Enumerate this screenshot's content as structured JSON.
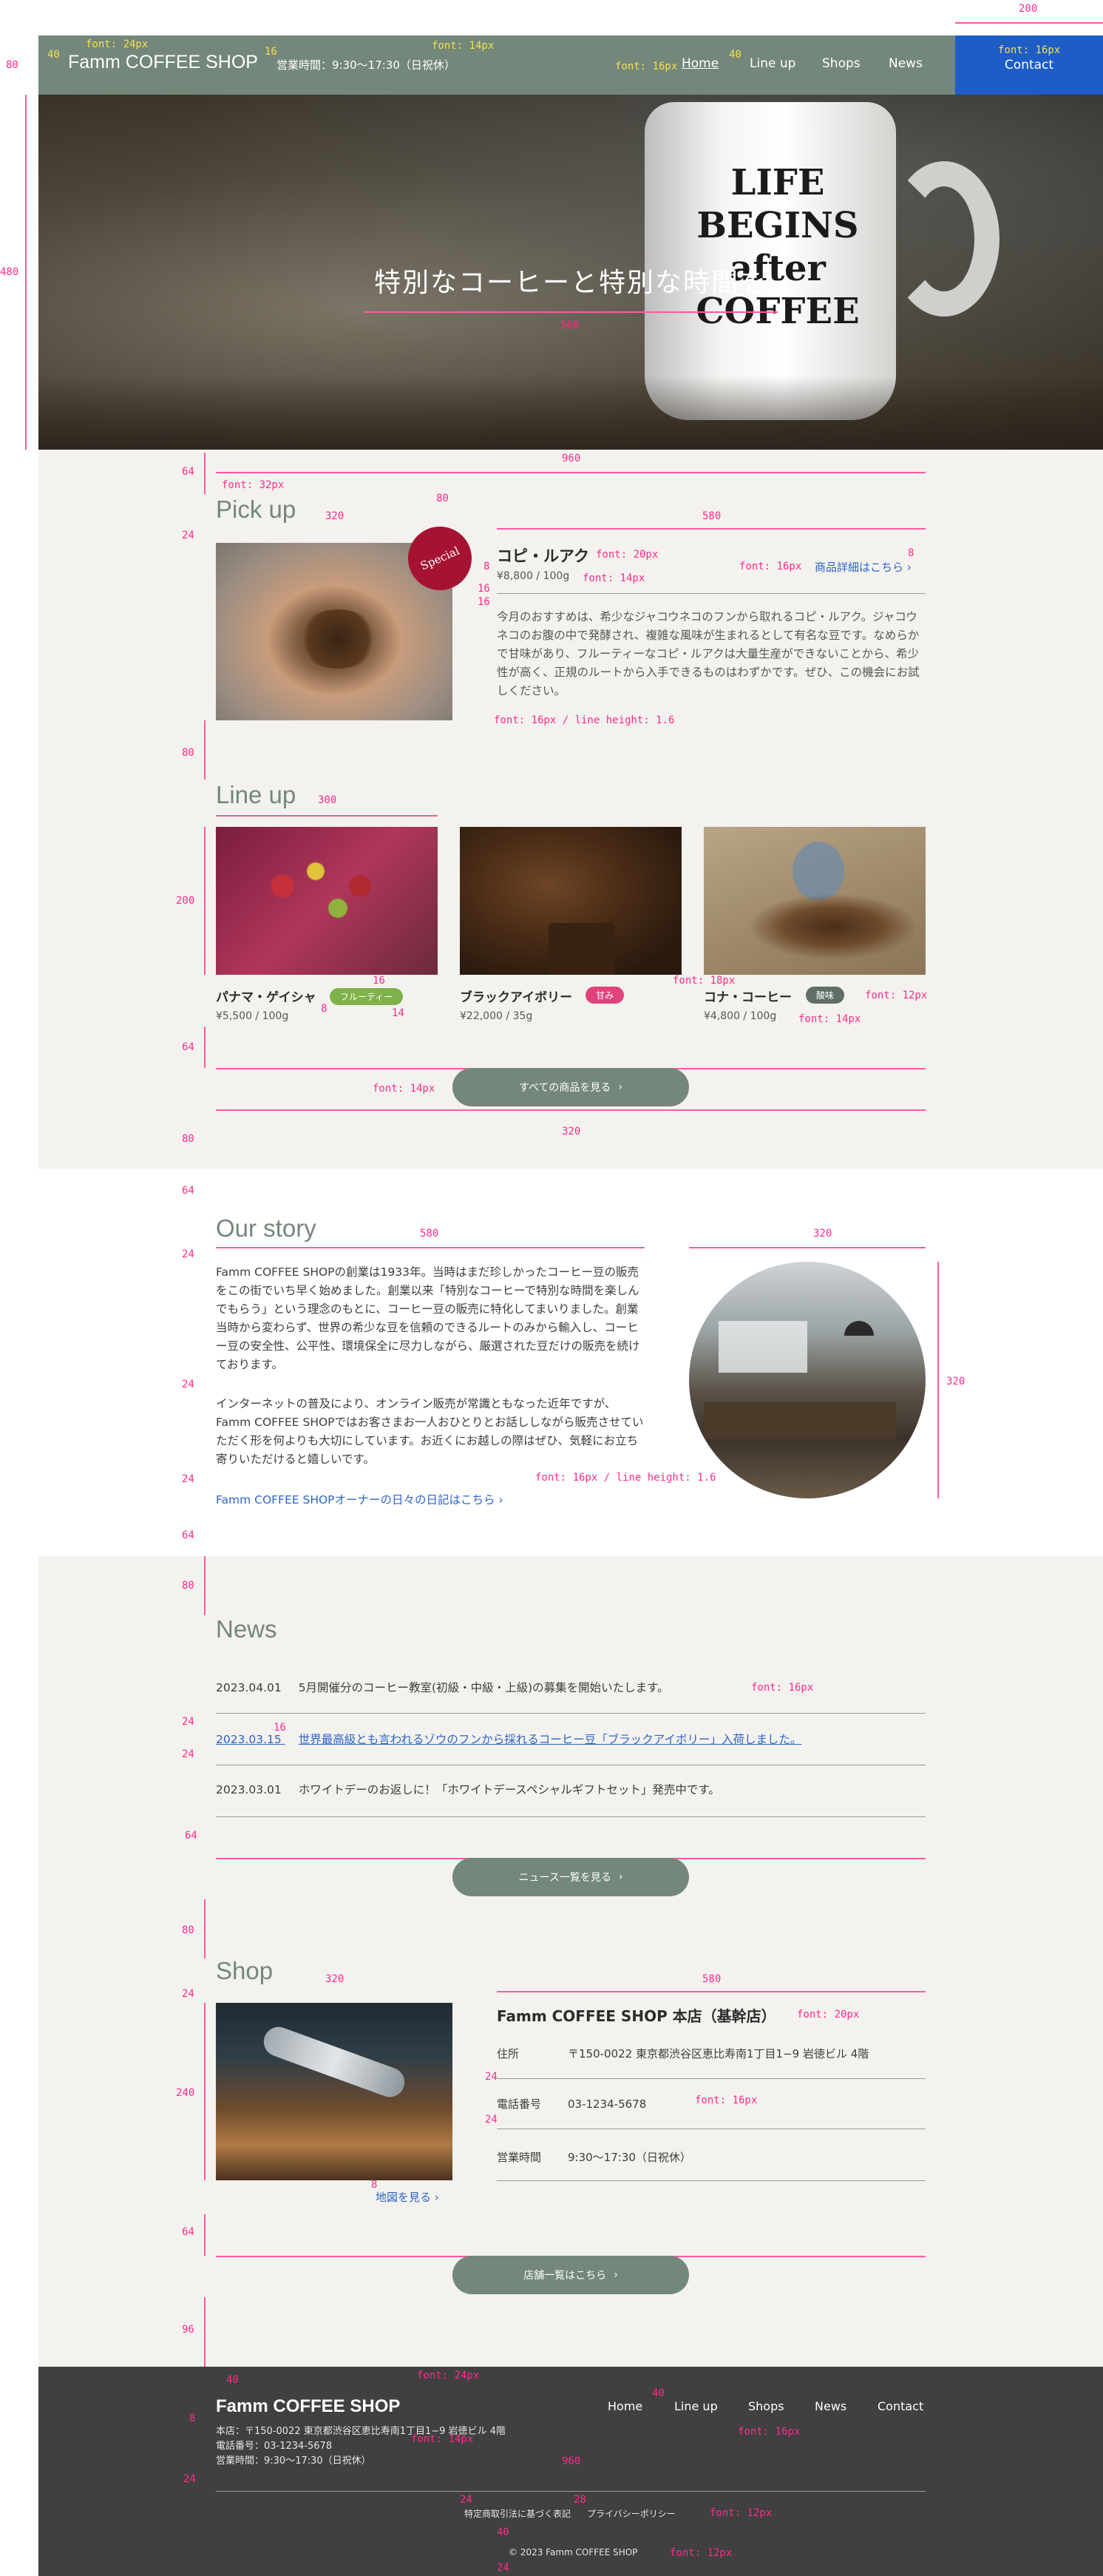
{
  "header": {
    "logo": "Famm COFFEE SHOP",
    "hours": "営業時間：9:30〜17:30（日祝休）",
    "nav": [
      "Home",
      "Line up",
      "Shops",
      "News"
    ],
    "contact": "Contact"
  },
  "hero": {
    "title": "特別なコーヒーと特別な時間を",
    "mug_text": "LIFE BEGINS after COFFEE"
  },
  "pickup": {
    "heading": "Pick up",
    "badge": "Special",
    "name": "コピ・ルアク",
    "price": "¥8,800 / 100g",
    "detail_link": "商品詳細はこちら",
    "description": "今月のおすすめは、希少なジャコウネコのフンから取れるコピ・ルアク。ジャコウネコのお腹の中で発酵され、複雑な風味が生まれるとして有名な豆です。なめらかで甘味があり、フルーティーなコピ・ルアクは大量生産ができないことから、希少性が高く、正規のルートから入手できるものはわずかです。ぜひ、この機会にお試しください。"
  },
  "lineup": {
    "heading": "Line up",
    "items": [
      {
        "name": "パナマ・ゲイシャ",
        "tag": "フルーティー",
        "tag_color": "#7fb24a",
        "price": "¥5,500 / 100g"
      },
      {
        "name": "ブラックアイボリー",
        "tag": "甘み",
        "tag_color": "#e0437b",
        "price": "¥22,000 / 35g"
      },
      {
        "name": "コナ・コーヒー",
        "tag": "酸味",
        "tag_color": "#5f6e66",
        "price": "¥4,800 / 100g"
      }
    ],
    "button": "すべての商品を見る"
  },
  "story": {
    "heading": "Our story",
    "para1": "Famm COFFEE SHOPの創業は1933年。当時はまだ珍しかったコーヒー豆の販売をこの街でいち早く始めました。創業以来「特別なコーヒーで特別な時間を楽しんでもらう」という理念のもとに、コーヒー豆の販売に特化してまいりました。創業当時から変わらず、世界の希少な豆を信頼のできるルートのみから輸入し、コーヒー豆の安全性、公平性、環境保全に尽力しながら、厳選された豆だけの販売を続けております。",
    "para2": "インターネットの普及により、オンライン販売が常識ともなった近年ですが、Famm COFFEE SHOPではお客さまお一人おひとりとお話ししながら販売させていただく形を何よりも大切にしています。お近くにお越しの際はぜひ、気軽にお立ち寄りいただけると嬉しいです。",
    "link": "Famm COFFEE SHOPオーナーの日々の日記はこちら"
  },
  "news": {
    "heading": "News",
    "items": [
      {
        "date": "2023.04.01",
        "text": "5月開催分のコーヒー教室(初級・中級・上級)の募集を開始いたします。",
        "link": false
      },
      {
        "date": "2023.03.15",
        "text": "世界最高級とも言われるゾウのフンから採れるコーヒー豆「ブラックアイボリー」入荷しました。",
        "link": true
      },
      {
        "date": "2023.03.01",
        "text": "ホワイトデーのお返しに！「ホワイトデースペシャルギフトセット」発売中です。",
        "link": false
      }
    ],
    "button": "ニュース一覧を見る"
  },
  "shop": {
    "heading": "Shop",
    "name": "Famm COFFEE SHOP 本店（基幹店）",
    "rows": [
      {
        "label": "住所",
        "value": "〒150-0022 東京都渋谷区恵比寿南1丁目1−9 岩徳ビル 4階"
      },
      {
        "label": "電話番号",
        "value": "03-1234-5678"
      },
      {
        "label": "営業時間",
        "value": "9:30〜17:30（日祝休）"
      }
    ],
    "map_link": "地図を見る",
    "button": "店舗一覧はこちら"
  },
  "footer": {
    "logo": "Famm COFFEE SHOP",
    "address": "本店：〒150-0022 東京都渋谷区恵比寿南1丁目1−9 岩徳ビル 4階",
    "phone": "電話番号：03-1234-5678",
    "hours": "営業時間：9:30〜17:30（日祝休）",
    "nav": [
      "Home",
      "Line up",
      "Shops",
      "News",
      "Contact"
    ],
    "legal_links": [
      "特定商取引法に基づく表記",
      "プライバシーポリシー"
    ],
    "copyright": "© 2023 Famm COFFEE SHOP"
  },
  "spec": {
    "h80": "80",
    "h480": "480",
    "w200": "200",
    "w560": "560",
    "w960": "960",
    "w320": "320",
    "w580": "580",
    "w300": "300",
    "n64": "64",
    "n24": "24",
    "n40": "40",
    "n16": "16",
    "n8": "8",
    "n14": "14",
    "n200": "200",
    "n240": "240",
    "n96": "96",
    "n28": "28",
    "f12": "font: 12px",
    "f14": "font: 14px",
    "f16": "font: 16px",
    "f18": "font: 18px",
    "f20": "font: 20px",
    "f24": "font: 24px",
    "f32": "font: 32px",
    "f16lh": "font: 16px / line height: 1.6"
  },
  "colors": {
    "accent": "#73877b",
    "contact": "#1e5cc6",
    "bg": "#f3f2ee",
    "footer": "#404040",
    "link": "#2f63c9",
    "spec": "#ff2a8a"
  }
}
